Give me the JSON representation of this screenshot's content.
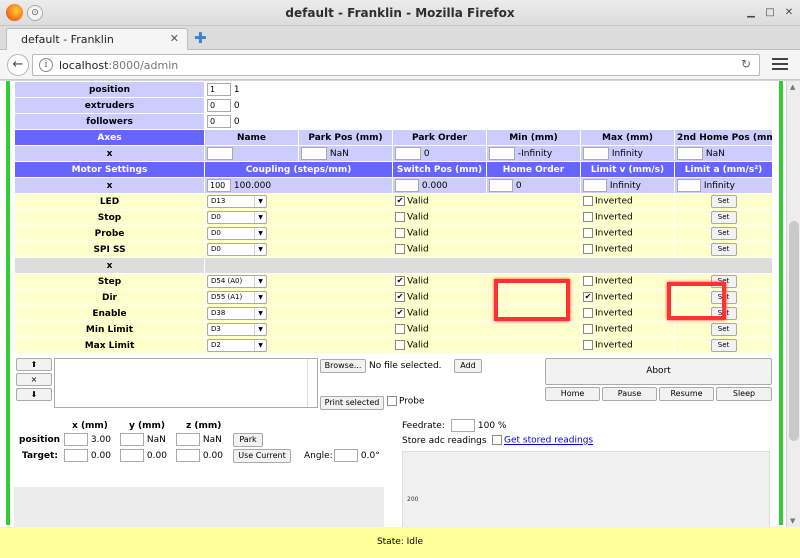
{
  "window": {
    "title": "default - Franklin - Mozilla Firefox"
  },
  "browser": {
    "tab_title": "default - Franklin",
    "url_host": "localhost",
    "url_path": ":8000/admin"
  },
  "top_rows": [
    {
      "label": "position",
      "input": "1",
      "value": "1"
    },
    {
      "label": "extruders",
      "input": "0",
      "value": "0"
    },
    {
      "label": "followers",
      "input": "0",
      "value": "0"
    }
  ],
  "axes_header": [
    "Axes",
    "Name",
    "Park Pos (mm)",
    "Park Order",
    "Min (mm)",
    "Max (mm)",
    "2nd Home Pos (mm)"
  ],
  "axes_row": {
    "label": "x",
    "park_pos": "NaN",
    "park_order": "0",
    "min": "-Infinity",
    "max": "Infinity",
    "home2": "NaN"
  },
  "motor_header": [
    "Motor Settings",
    "Coupling (steps/mm)",
    "Switch Pos (mm)",
    "Home Order",
    "Limit v (mm/s)",
    "Limit a (mm/s²)"
  ],
  "motor_row": {
    "label": "x",
    "coupling_input": "100",
    "coupling": "100.000",
    "switch_pos": "0.000",
    "home_order": "0",
    "limit_v": "Infinity",
    "limit_a": "Infinity"
  },
  "pins_top": [
    {
      "label": "LED",
      "pin": "D13",
      "valid": "✔",
      "inverted": ""
    },
    {
      "label": "Stop",
      "pin": "D0",
      "valid": "",
      "inverted": ""
    },
    {
      "label": "Probe",
      "pin": "D0",
      "valid": "",
      "inverted": ""
    },
    {
      "label": "SPI SS",
      "pin": "D0",
      "valid": "",
      "inverted": ""
    }
  ],
  "section_label": "x",
  "pins_axis": [
    {
      "label": "Step",
      "pin": "D54 (A0)",
      "valid": "✔",
      "inverted": ""
    },
    {
      "label": "Dir",
      "pin": "D55 (A1)",
      "valid": "✔",
      "inverted": "✔"
    },
    {
      "label": "Enable",
      "pin": "D38",
      "valid": "✔",
      "inverted": ""
    },
    {
      "label": "Min Limit",
      "pin": "D3",
      "valid": "",
      "inverted": ""
    },
    {
      "label": "Max Limit",
      "pin": "D2",
      "valid": "",
      "inverted": ""
    }
  ],
  "labels": {
    "valid": "Valid",
    "inverted": "Inverted",
    "set": "Set"
  },
  "gcode": {
    "up": "⬆",
    "clear": "×",
    "down": "⬇",
    "browse": "Browse...",
    "no_file": "No file selected.",
    "add": "Add",
    "print_selected": "Print selected",
    "probe": "Probe",
    "abort": "Abort",
    "home": "Home",
    "pause": "Pause",
    "resume": "Resume",
    "sleep": "Sleep"
  },
  "position_panel": {
    "headers": [
      "x (mm)",
      "y (mm)",
      "z (mm)"
    ],
    "position_label": "position",
    "position_values": [
      "3.00",
      "NaN",
      "NaN"
    ],
    "park": "Park",
    "target_label": "Target:",
    "target_values": [
      "0.00",
      "0.00",
      "0.00"
    ],
    "use_current": "Use Current",
    "angle_label": "Angle:",
    "angle_value": "0.0°"
  },
  "feed_panel": {
    "feedrate_label": "Feedrate:",
    "feedrate_value": "100 %",
    "adc_label": "Store adc readings",
    "adc_link": "Get stored readings",
    "graph_tick": "200"
  },
  "status": "State: Idle",
  "colors": {
    "accent_green": "#33cc33",
    "header_blue": "#6666ff",
    "lavender": "#ccccff",
    "pin_yellow": "#ffffcc",
    "highlight_red": "#ff3333"
  }
}
